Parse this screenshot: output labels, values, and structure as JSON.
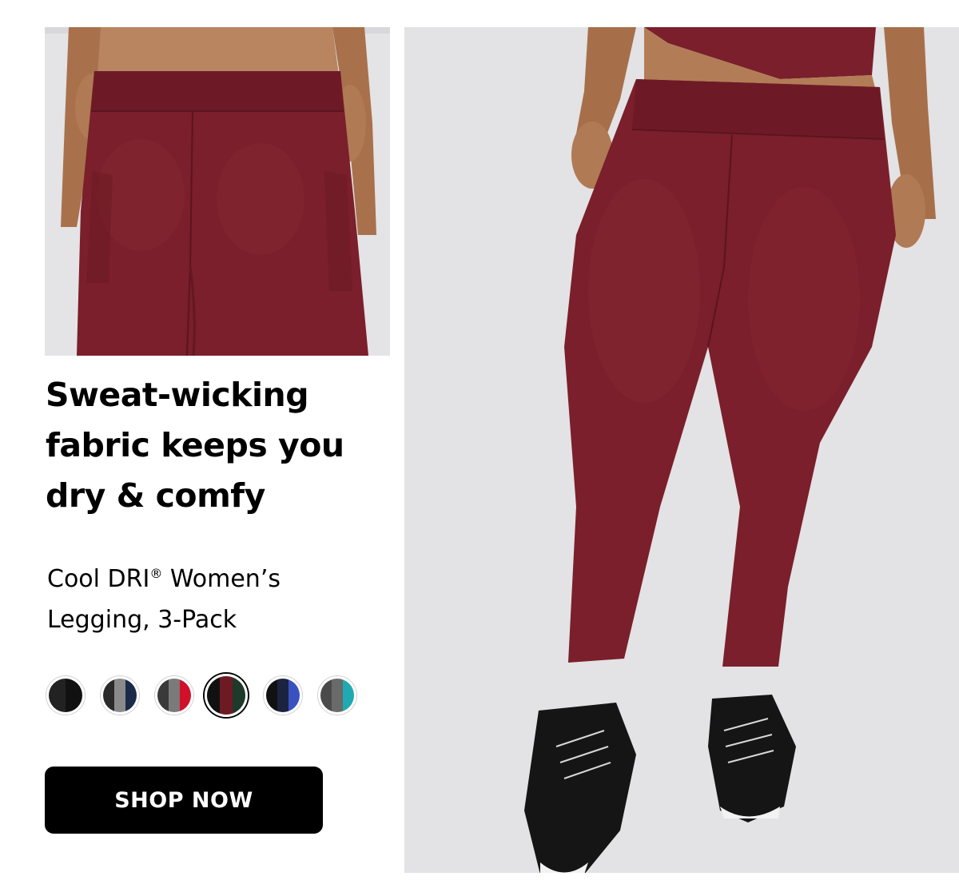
{
  "hero": {
    "headline": [
      "Sweat-wicking",
      "fabric keeps you",
      "dry & comfy"
    ],
    "product_name_prefix": "Cool DRI",
    "product_name_reg": "®",
    "product_name_line1_suffix": " Women’s",
    "product_name_line2": "Legging, 3-Pack",
    "cta_label": "SHOP NOW"
  },
  "images": {
    "back_view": "burgundy-legging-back-view-photo",
    "front_view": "burgundy-legging-front-view-photo"
  },
  "colors": {
    "legging": "#7a1f2b",
    "photo_background": "#e3e2e4",
    "button": "#000000"
  },
  "swatches": [
    {
      "name": "black-swatch",
      "colors": [
        "#222222",
        "#111111"
      ],
      "selected": false
    },
    {
      "name": "black-gray-navy-swatch",
      "colors": [
        "#2a2a2a",
        "#8a8a8a",
        "#1c2a4a"
      ],
      "selected": false
    },
    {
      "name": "charcoal-gray-red-swatch",
      "colors": [
        "#3a3a3a",
        "#7a7a7a",
        "#d0102a"
      ],
      "selected": false
    },
    {
      "name": "black-burgundy-green-swatch",
      "colors": [
        "#111111",
        "#6e1a25",
        "#1e3a2a"
      ],
      "selected": true
    },
    {
      "name": "black-navy-blue-swatch",
      "colors": [
        "#111111",
        "#1a2440",
        "#3a52c0"
      ],
      "selected": false
    },
    {
      "name": "gray-teal-swatch",
      "colors": [
        "#4a4a4a",
        "#6a6a6a",
        "#1eaab0"
      ],
      "selected": false
    }
  ]
}
